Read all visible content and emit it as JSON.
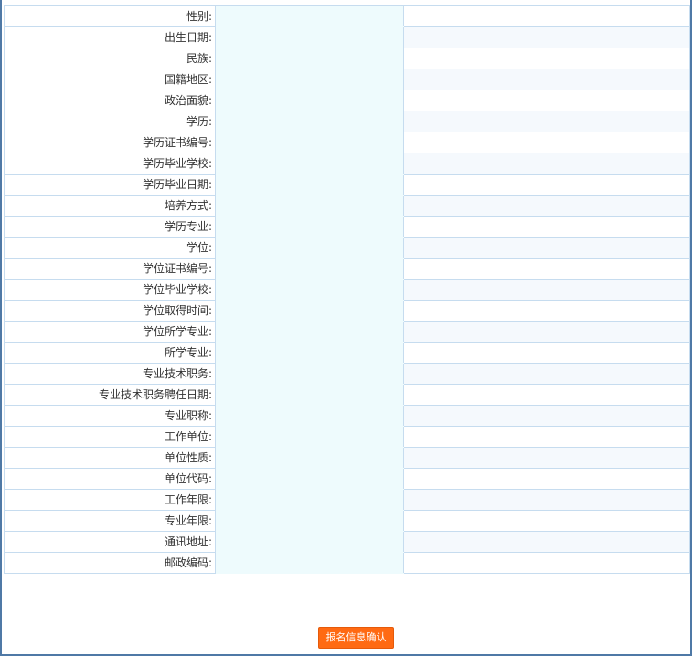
{
  "form": {
    "rows": [
      {
        "label": "性别:",
        "value": ""
      },
      {
        "label": "出生日期:",
        "value": ""
      },
      {
        "label": "民族:",
        "value": ""
      },
      {
        "label": "国籍地区:",
        "value": ""
      },
      {
        "label": "政治面貌:",
        "value": ""
      },
      {
        "label": "学历:",
        "value": ""
      },
      {
        "label": "学历证书编号:",
        "value": ""
      },
      {
        "label": "学历毕业学校:",
        "value": ""
      },
      {
        "label": "学历毕业日期:",
        "value": ""
      },
      {
        "label": "培养方式:",
        "value": ""
      },
      {
        "label": "学历专业:",
        "value": ""
      },
      {
        "label": "学位:",
        "value": ""
      },
      {
        "label": "学位证书编号:",
        "value": ""
      },
      {
        "label": "学位毕业学校:",
        "value": ""
      },
      {
        "label": "学位取得时间:",
        "value": ""
      },
      {
        "label": "学位所学专业:",
        "value": ""
      },
      {
        "label": "所学专业:",
        "value": ""
      },
      {
        "label": "专业技术职务:",
        "value": ""
      },
      {
        "label": "专业技术职务聘任日期:",
        "value": ""
      },
      {
        "label": "专业职称:",
        "value": ""
      },
      {
        "label": "工作单位:",
        "value": ""
      },
      {
        "label": "单位性质:",
        "value": ""
      },
      {
        "label": "单位代码:",
        "value": ""
      },
      {
        "label": "工作年限:",
        "value": ""
      },
      {
        "label": "专业年限:",
        "value": ""
      },
      {
        "label": "通讯地址:",
        "value": ""
      },
      {
        "label": "邮政编码:",
        "value": ""
      }
    ]
  },
  "actions": {
    "confirm_label": "报名信息确认"
  },
  "colors": {
    "frame_border": "#4f79a6",
    "row_border": "#c6dcef",
    "value_cell_bg": "#eefbfd",
    "alt_row_bg": "#f5f9fd",
    "button_bg": "#ff6a13"
  }
}
